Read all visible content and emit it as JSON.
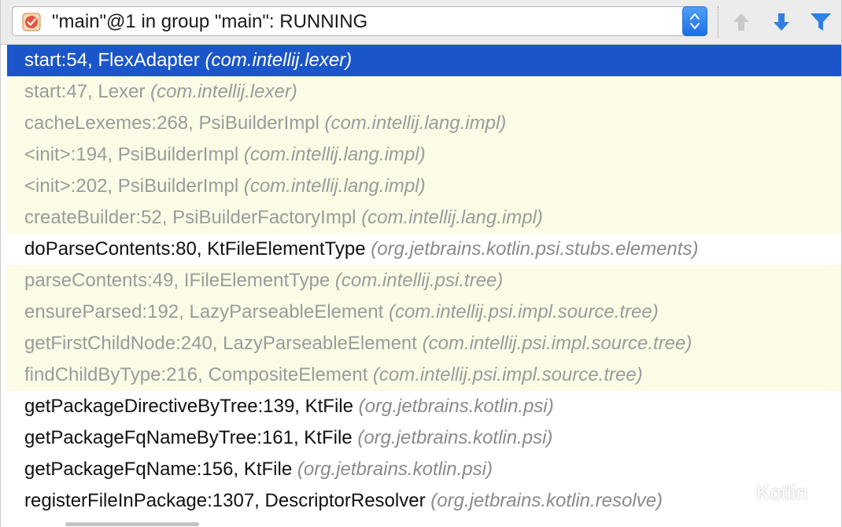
{
  "thread_selector": {
    "value": "\"main\"@1 in group \"main\": RUNNING",
    "status_icon": "thread-running-icon"
  },
  "toolbar": {
    "up_icon": "arrow-up-icon",
    "down_icon": "arrow-down-icon",
    "filter_icon": "filter-icon"
  },
  "frames": [
    {
      "method": "start:54, FlexAdapter",
      "pkg": "(com.intellij.lexer)",
      "kind": "selected"
    },
    {
      "method": "start:47, Lexer",
      "pkg": "(com.intellij.lexer)",
      "kind": "lib"
    },
    {
      "method": "cacheLexemes:268, PsiBuilderImpl",
      "pkg": "(com.intellij.lang.impl)",
      "kind": "lib"
    },
    {
      "method": "<init>:194, PsiBuilderImpl",
      "pkg": "(com.intellij.lang.impl)",
      "kind": "lib"
    },
    {
      "method": "<init>:202, PsiBuilderImpl",
      "pkg": "(com.intellij.lang.impl)",
      "kind": "lib"
    },
    {
      "method": "createBuilder:52, PsiBuilderFactoryImpl",
      "pkg": "(com.intellij.lang.impl)",
      "kind": "lib"
    },
    {
      "method": "doParseContents:80, KtFileElementType",
      "pkg": "(org.jetbrains.kotlin.psi.stubs.elements)",
      "kind": "user"
    },
    {
      "method": "parseContents:49, IFileElementType",
      "pkg": "(com.intellij.psi.tree)",
      "kind": "lib"
    },
    {
      "method": "ensureParsed:192, LazyParseableElement",
      "pkg": "(com.intellij.psi.impl.source.tree)",
      "kind": "lib"
    },
    {
      "method": "getFirstChildNode:240, LazyParseableElement",
      "pkg": "(com.intellij.psi.impl.source.tree)",
      "kind": "lib"
    },
    {
      "method": "findChildByType:216, CompositeElement",
      "pkg": "(com.intellij.psi.impl.source.tree)",
      "kind": "lib"
    },
    {
      "method": "getPackageDirectiveByTree:139, KtFile",
      "pkg": "(org.jetbrains.kotlin.psi)",
      "kind": "user"
    },
    {
      "method": "getPackageFqNameByTree:161, KtFile",
      "pkg": "(org.jetbrains.kotlin.psi)",
      "kind": "user"
    },
    {
      "method": "getPackageFqName:156, KtFile",
      "pkg": "(org.jetbrains.kotlin.psi)",
      "kind": "user"
    },
    {
      "method": "registerFileInPackage:1307, DescriptorResolver",
      "pkg": "(org.jetbrains.kotlin.resolve)",
      "kind": "user"
    }
  ],
  "watermark": {
    "text": "Kotlin",
    "icon": "wechat-icon"
  },
  "colors": {
    "selection": "#1a56c9",
    "library_frame_bg": "#fbfbe6",
    "accent_blue": "#2f80e6"
  }
}
